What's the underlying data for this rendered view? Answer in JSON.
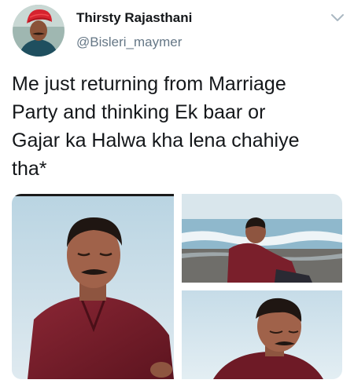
{
  "tweet": {
    "author": {
      "display_name": "Thirsty Rajasthani",
      "handle": "@Bisleri_maymer"
    },
    "menu_icon": "chevron-down-icon",
    "text": "Me just returning from Marriage\nParty and thinking Ek baar or\nGajar ka Halwa kha lena chahiye\ntha*",
    "media_count": 3
  },
  "colors": {
    "text": "#14171a",
    "secondary_text": "#657786",
    "chevron": "#aab8c2",
    "turban": "#d6232f",
    "shirt": "#7a1f2b",
    "sky": "#cfe2ee",
    "sea": "#8fb8cc",
    "skin": "#a0624a"
  }
}
